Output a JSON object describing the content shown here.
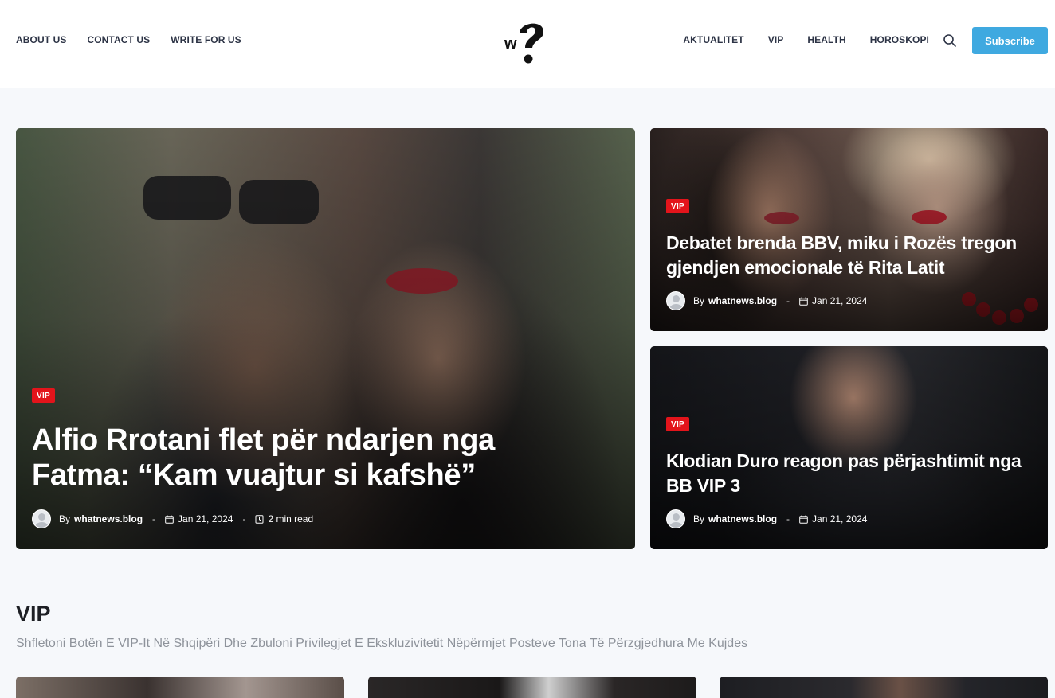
{
  "header": {
    "nav_left": [
      "ABOUT US",
      "CONTACT US",
      "WRITE FOR US"
    ],
    "nav_right": [
      "AKTUALITET",
      "VIP",
      "HEALTH",
      "HOROSKOPI"
    ],
    "subscribe_label": "Subscribe",
    "logo_text": "w",
    "brand_color": "#3fa9e0"
  },
  "featured": {
    "main": {
      "category": "VIP",
      "title": "Alfio Rrotani flet për ndarjen nga Fatma: “Kam vuajtur si kafshë”",
      "by": "By",
      "author": "whatnews.blog",
      "date": "Jan 21, 2024",
      "read_time": "2 min read"
    },
    "side": [
      {
        "category": "VIP",
        "title": "Debatet brenda BBV, miku i Rozës tregon gjendjen emocionale të Rita Latit",
        "by": "By",
        "author": "whatnews.blog",
        "date": "Jan 21, 2024"
      },
      {
        "category": "VIP",
        "title": "Klodian Duro reagon pas përjashtimit nga BB VIP 3",
        "by": "By",
        "author": "whatnews.blog",
        "date": "Jan 21, 2024"
      }
    ]
  },
  "section": {
    "title": "VIP",
    "subtitle": "Shfletoni Botën E VIP-It Në Shqipëri Dhe Zbuloni Privilegjet E Ekskluzivitetit Nëpërmjet Posteve Tona Të Përzgjedhura Me Kujdes"
  },
  "colors": {
    "badge": "#e3141b",
    "page_bg": "#f6f8fb",
    "header_bg": "#ffffff"
  },
  "icons": [
    "logo-icon",
    "search-icon",
    "calendar-icon",
    "clock-icon",
    "avatar-icon"
  ]
}
